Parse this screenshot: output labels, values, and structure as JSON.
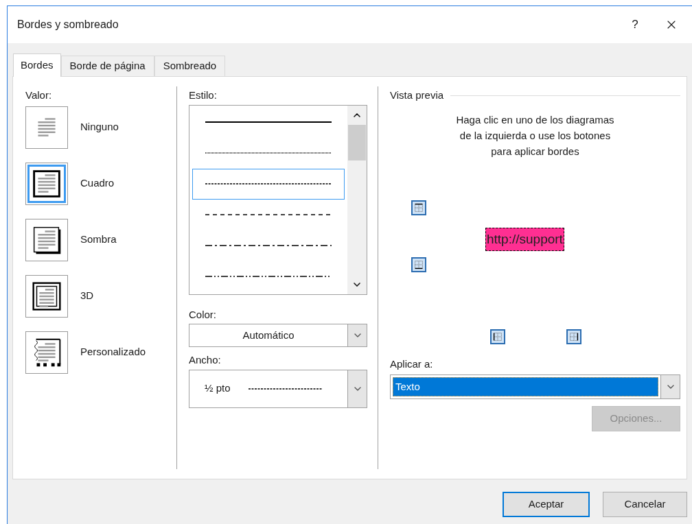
{
  "window": {
    "title": "Bordes y sombreado",
    "help": "?"
  },
  "tabs": [
    {
      "label": "Bordes",
      "selected": true
    },
    {
      "label": "Borde de página",
      "selected": false
    },
    {
      "label": "Sombreado",
      "selected": false
    }
  ],
  "setting": {
    "label": "Valor:",
    "items": [
      {
        "label": "Ninguno",
        "kind": "none",
        "selected": false
      },
      {
        "label": "Cuadro",
        "kind": "box",
        "selected": true
      },
      {
        "label": "Sombra",
        "kind": "shadow",
        "selected": false
      },
      {
        "label": "3D",
        "kind": "three_d",
        "selected": false
      },
      {
        "label": "Personalizado",
        "kind": "custom",
        "selected": false
      }
    ]
  },
  "style": {
    "label": "Estilo:",
    "items": [
      {
        "kind": "solid",
        "selected": false
      },
      {
        "kind": "dotted",
        "selected": false
      },
      {
        "kind": "fine_dash",
        "selected": true
      },
      {
        "kind": "dash",
        "selected": false
      },
      {
        "kind": "dash_dot",
        "selected": false
      },
      {
        "kind": "dash_dot_dot",
        "selected": false
      }
    ]
  },
  "color": {
    "label": "Color:",
    "value": "Automático"
  },
  "width": {
    "label": "Ancho:",
    "value": "½ pto"
  },
  "preview": {
    "title": "Vista previa",
    "instructions": "Haga clic en uno de los diagramas de la izquierda o use los botones para aplicar bordes",
    "sample_text": "http://support"
  },
  "apply_to": {
    "label": "Aplicar a:",
    "value": "Texto"
  },
  "options_button": {
    "label": "Opciones...",
    "disabled": true
  },
  "buttons": [
    {
      "label": "Aceptar",
      "default": true
    },
    {
      "label": "Cancelar",
      "default": false
    }
  ]
}
